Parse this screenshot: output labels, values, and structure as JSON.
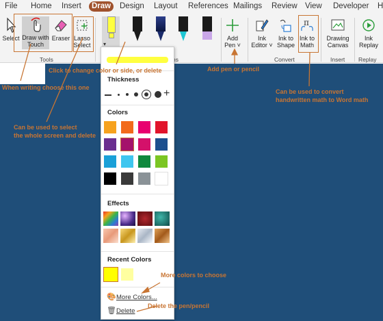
{
  "tabs": [
    "File",
    "Home",
    "Insert",
    "Draw",
    "Design",
    "Layout",
    "References",
    "Mailings",
    "Review",
    "View",
    "Developer",
    "H"
  ],
  "ribbon": {
    "select": "Select",
    "draw_with_touch": [
      "Draw with",
      "Touch"
    ],
    "eraser": "Eraser",
    "lasso_select": [
      "Lasso",
      "Select"
    ],
    "tools_group": "Tools",
    "pens_group_tail": "ns",
    "add_pen": [
      "Add",
      "Pen"
    ],
    "ink_editor": [
      "Ink",
      "Editor"
    ],
    "ink_to_shape": [
      "Ink to",
      "Shape"
    ],
    "ink_to_math": [
      "Ink to",
      "Math"
    ],
    "convert_group": "Convert",
    "drawing_canvas": [
      "Drawing",
      "Canvas"
    ],
    "insert_group": "Insert",
    "ink_replay": [
      "Ink",
      "Replay"
    ],
    "replay_group": "Replay"
  },
  "panel": {
    "thickness": "Thickness",
    "colors": "Colors",
    "effects": "Effects",
    "recent_colors": "Recent Colors",
    "more_colors": "More Colors...",
    "delete": "Delete",
    "color_grid": [
      "#f6a21e",
      "#f26a1b",
      "#e8006f",
      "#e1142c",
      "#6a2f8f",
      "#a4126b",
      "#d4116a",
      "#1c4f8e",
      "#1aa0d8",
      "#3fc6ef",
      "#10893e",
      "#7bc623",
      "#000000",
      "#3a3a3a",
      "#8a9297",
      "#ffffff"
    ],
    "recent": [
      "#ffff00",
      "#ffffa0"
    ],
    "highlight_color": "#ffff40"
  },
  "annotations": {
    "click_change": "Click to change color or side, or delete",
    "add_pen_note": "Add pen or pencil",
    "when_writing": "When writing choose this one",
    "lasso_note": [
      "Can be used to select",
      "the whole screen and delete"
    ],
    "math_note": [
      "Can be used to convert",
      "handwritten math to Word math"
    ],
    "more_colors_note": "More colors to choose",
    "delete_note": "Delete the pen/pencil"
  }
}
